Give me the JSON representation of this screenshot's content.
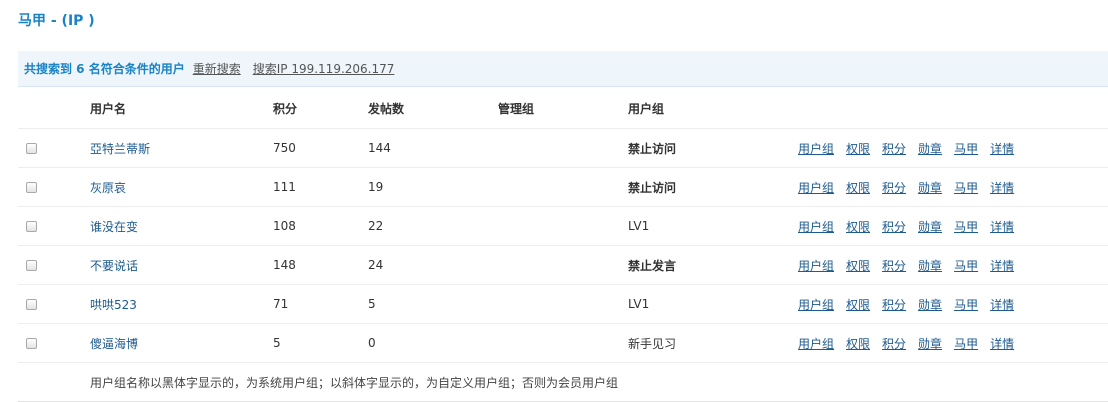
{
  "page": {
    "title": "马甲 - (IP )"
  },
  "summary": {
    "count_text": "共搜索到 6 名符合条件的用户",
    "research_label": "重新搜索",
    "search_ip_label": "搜索IP 199.119.206.177"
  },
  "table": {
    "headers": {
      "username": "用户名",
      "credits": "积分",
      "posts": "发帖数",
      "admin_group": "管理组",
      "user_group": "用户组"
    },
    "rows": [
      {
        "username": "亞特兰蒂斯",
        "credits": "750",
        "posts": "144",
        "admin_group": "",
        "user_group": "禁止访问"
      },
      {
        "username": "灰原哀",
        "credits": "111",
        "posts": "19",
        "admin_group": "",
        "user_group": "禁止访问"
      },
      {
        "username": "谁没在变",
        "credits": "108",
        "posts": "22",
        "admin_group": "",
        "user_group": "LV1"
      },
      {
        "username": "不要说话",
        "credits": "148",
        "posts": "24",
        "admin_group": "",
        "user_group": "禁止发言"
      },
      {
        "username": "哄哄523",
        "credits": "71",
        "posts": "5",
        "admin_group": "",
        "user_group": "LV1"
      },
      {
        "username": "傻逼海博",
        "credits": "5",
        "posts": "0",
        "admin_group": "",
        "user_group": "新手见习"
      }
    ],
    "actions": {
      "user_group": "用户组",
      "permissions": "权限",
      "credits": "积分",
      "medals": "勋章",
      "sockpuppet": "马甲",
      "details": "详情"
    },
    "footer_note": "用户组名称以黑体字显示的，为系统用户组；以斜体字显示的，为自定义用户组；否则为会员用户组"
  },
  "colors": {
    "title": "#1a83c6",
    "summary_background": "#eef5fb",
    "link": "#1d5a8e"
  }
}
